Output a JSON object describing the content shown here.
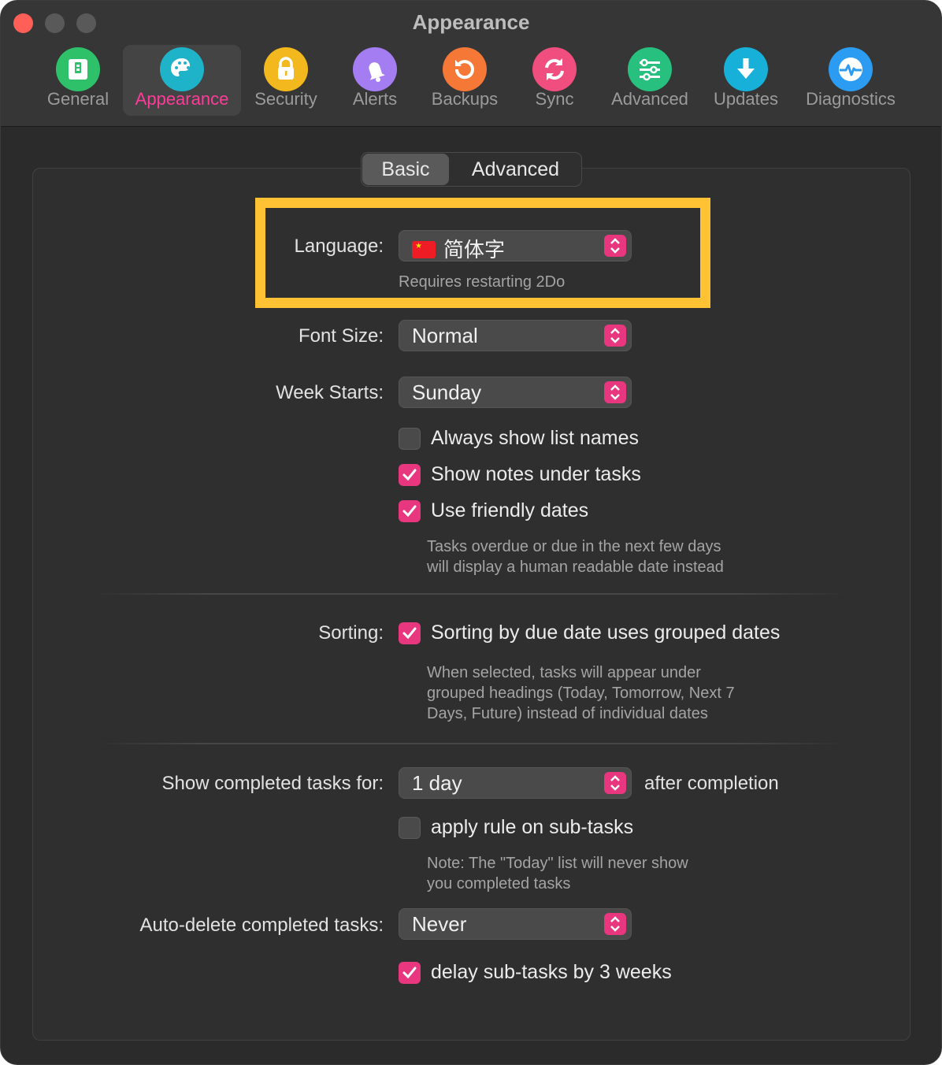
{
  "window": {
    "title": "Appearance"
  },
  "toolbar": {
    "items": [
      {
        "label": "General",
        "icon": "general-icon",
        "color": "#2ec16a"
      },
      {
        "label": "Appearance",
        "icon": "palette-icon",
        "color": "#1fb3c9"
      },
      {
        "label": "Security",
        "icon": "lock-icon",
        "color": "#f2b81d"
      },
      {
        "label": "Alerts",
        "icon": "bell-icon",
        "color": "#a57df2"
      },
      {
        "label": "Backups",
        "icon": "backup-icon",
        "color": "#f57836"
      },
      {
        "label": "Sync",
        "icon": "sync-icon",
        "color": "#f04e7e"
      },
      {
        "label": "Advanced",
        "icon": "sliders-icon",
        "color": "#27c07f"
      },
      {
        "label": "Updates",
        "icon": "download-icon",
        "color": "#17b0d9"
      },
      {
        "label": "Diagnostics",
        "icon": "pulse-icon",
        "color": "#2b9cf2"
      }
    ],
    "active": "Appearance"
  },
  "tabs": {
    "basic": "Basic",
    "advanced": "Advanced",
    "selected": "Basic"
  },
  "language": {
    "label": "Language:",
    "value": "简体字",
    "flag": "china-flag-icon",
    "hint": "Requires restarting 2Do"
  },
  "font_size": {
    "label": "Font Size:",
    "value": "Normal"
  },
  "week_starts": {
    "label": "Week Starts:",
    "value": "Sunday"
  },
  "options": {
    "always_show_list_names": {
      "label": "Always show list names",
      "checked": false
    },
    "show_notes": {
      "label": "Show notes under tasks",
      "checked": true
    },
    "friendly_dates": {
      "label": "Use friendly dates",
      "checked": true
    },
    "friendly_hint_1": "Tasks overdue or due in the next few days",
    "friendly_hint_2": "will display a human readable date instead"
  },
  "sorting": {
    "label": "Sorting:",
    "option": "Sorting by due date uses grouped dates",
    "checked": true,
    "hint_1": "When selected, tasks will appear under",
    "hint_2": "grouped headings (Today, Tomorrow, Next 7",
    "hint_3": "Days, Future) instead of individual dates"
  },
  "completed": {
    "label": "Show completed tasks for:",
    "value": "1 day",
    "suffix": "after completion",
    "subtasks": {
      "label": "apply rule on sub-tasks",
      "checked": false
    },
    "note_1": "Note: The \"Today\" list will never show",
    "note_2": "you completed tasks"
  },
  "auto_delete": {
    "label": "Auto-delete completed tasks:",
    "value": "Never",
    "delay": {
      "label": "delay sub-tasks by 3 weeks",
      "checked": true
    }
  },
  "colors": {
    "accent": "#e8377f",
    "highlight": "#ffc234",
    "active_label": "#ff3b9a"
  }
}
